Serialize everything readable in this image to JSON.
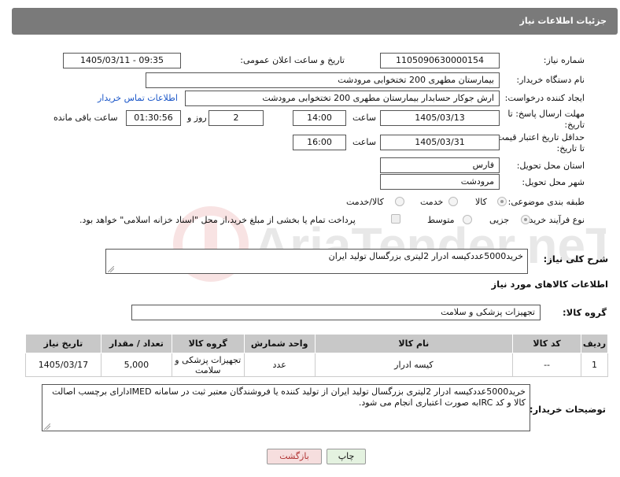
{
  "header": {
    "title": "جزئیات اطلاعات نیاز"
  },
  "fields": {
    "need_number_label": "شماره نیاز:",
    "need_number": "1105090630000154",
    "announce_label": "تاریخ و ساعت اعلان عمومی:",
    "announce_value": "1405/03/11 - 09:35",
    "buyer_org_label": "نام دستگاه خریدار:",
    "buyer_org": "بیمارستان مطهری  200 تختخوابی مرودشت",
    "creator_label": "ایجاد کننده درخواست:",
    "creator": "ارش  جوکار حسابدار بیمارستان مطهری  200 تختخوابی مرودشت",
    "contact_link": "اطلاعات تماس خریدار",
    "deadline_label_1": "مهلت ارسال پاسخ: تا",
    "deadline_label_2": "تاریخ:",
    "deadline_date": "1405/03/13",
    "time_label": "ساعت",
    "deadline_time": "14:00",
    "days_value": "2",
    "days_label": "روز و",
    "remaining_value": "01:30:56",
    "remaining_label": "ساعت باقی مانده",
    "validity_label_1": "حداقل تاریخ اعتبار قیمت:",
    "validity_label_2": "تا تاریخ:",
    "validity_date": "1405/03/31",
    "validity_time_label": "ساعت",
    "validity_time": "16:00",
    "province_label": "استان محل تحویل:",
    "province": "فارس",
    "city_label": "شهر محل تحویل:",
    "city": "مرودشت",
    "category_label": "طبقه بندی موضوعی:",
    "category_options": [
      "کالا",
      "خدمت",
      "کالا/خدمت"
    ],
    "category_selected": "کالا",
    "process_label": "نوع فرآیند خرید :",
    "process_options": [
      "جزیی",
      "متوسط"
    ],
    "process_selected": "جزیی",
    "payment_note": "پرداخت تمام یا بخشی از مبلغ خرید،از محل \"اسناد خزانه اسلامی\" خواهد بود.",
    "summary_label": "شرح کلی نیاز:",
    "summary": "خرید5000عددکیسه ادرار 2لیتری بزرگسال  تولید ایران"
  },
  "goods": {
    "section_title": "اطلاعات کالاهای مورد نیاز",
    "group_label": "گروه کالا:",
    "group_value": "تجهیزات پزشکی و سلامت",
    "columns": [
      "ردیف",
      "کد کالا",
      "نام کالا",
      "واحد شمارش",
      "گروه کالا",
      "تعداد / مقدار",
      "تاریخ نیاز"
    ],
    "rows": [
      {
        "index": "1",
        "code": "--",
        "name": "کیسه ادرار",
        "unit": "عدد",
        "group": "تجهیزات پزشکی و سلامت",
        "qty": "5,000",
        "date": "1405/03/17"
      }
    ]
  },
  "buyer_notes": {
    "label": "توضیحات خریدار:",
    "text": "خرید5000عددکیسه ادرار 2لیتری بزرگسال  تولید ایران از تولید کننده یا فروشندگان معتبر ثبت در سامانه IMEDدارای برچسب اصالت کالا و کد IRCبه صورت اعتباری انجام می شود."
  },
  "buttons": {
    "print": "چاپ",
    "back": "بازگشت"
  },
  "watermark": "AriaTender.neT",
  "colors": {
    "header_bg": "#7a7a7a",
    "link": "#1a56c8",
    "back_bg": "#f6dede",
    "print_bg": "#e4f2e0"
  }
}
